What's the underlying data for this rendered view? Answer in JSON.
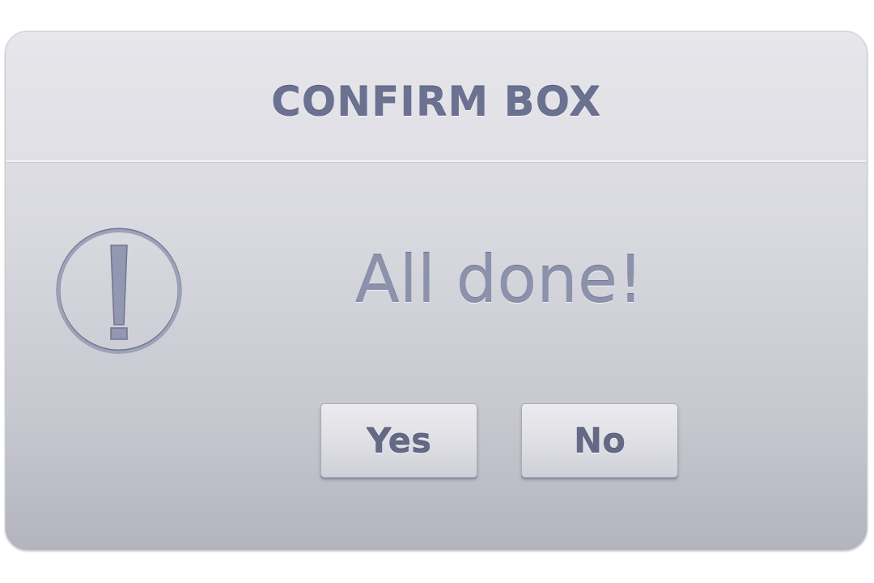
{
  "dialog": {
    "title": "CONFIRM BOX",
    "icon": "exclamation-circle-icon",
    "message": "All done!",
    "buttons": {
      "yes_label": "Yes",
      "no_label": "No"
    },
    "colors": {
      "text": "#6b7190",
      "message": "#8c92ab",
      "background_top": "#e4e4ea",
      "background_bottom": "#b3b4be"
    }
  }
}
